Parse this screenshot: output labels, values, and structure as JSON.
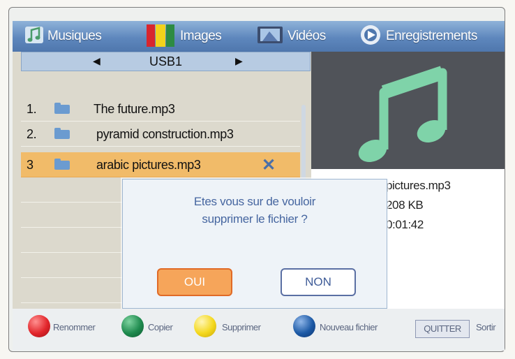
{
  "tabs": [
    {
      "label": "Musiques",
      "icon": "music-note-icon"
    },
    {
      "label": "Images",
      "icon": "color-pencils-icon"
    },
    {
      "label": "Vidéos",
      "icon": "video-film-icon"
    },
    {
      "label": "Enregistrements",
      "icon": "record-reel-icon"
    }
  ],
  "source": {
    "label": "USB1",
    "prev_icon": "left-arrow-icon",
    "next_icon": "right-arrow-icon"
  },
  "files": [
    {
      "num": "1.",
      "name": "The future.mp3"
    },
    {
      "num": "2.",
      "name": "pyramid construction.mp3"
    },
    {
      "num": "3",
      "name": "arabic pictures.mp3",
      "selected": true
    }
  ],
  "delete_mark": "✕",
  "preview": {
    "icon": "music-note-icon",
    "filename": "pictures.mp3",
    "size": "208 KB",
    "duration": "0:01:42"
  },
  "dialog": {
    "line1": "Etes vous sur de vouloir",
    "line2": "supprimer le fichier  ?",
    "yes": "OUI",
    "no": "NON"
  },
  "footer": {
    "rename": "Renommer",
    "copy": "Copier",
    "delete": "Supprimer",
    "new_file": "Nouveau fichier",
    "quit_key": "QUITTER",
    "quit_label": "Sortir"
  },
  "colors": {
    "red": "#e2262b",
    "green": "#1e8a4e",
    "yellow": "#f4d81d",
    "blue": "#1d5aa6",
    "selection": "#f1bb69",
    "tabbar": "#5e87bd"
  }
}
